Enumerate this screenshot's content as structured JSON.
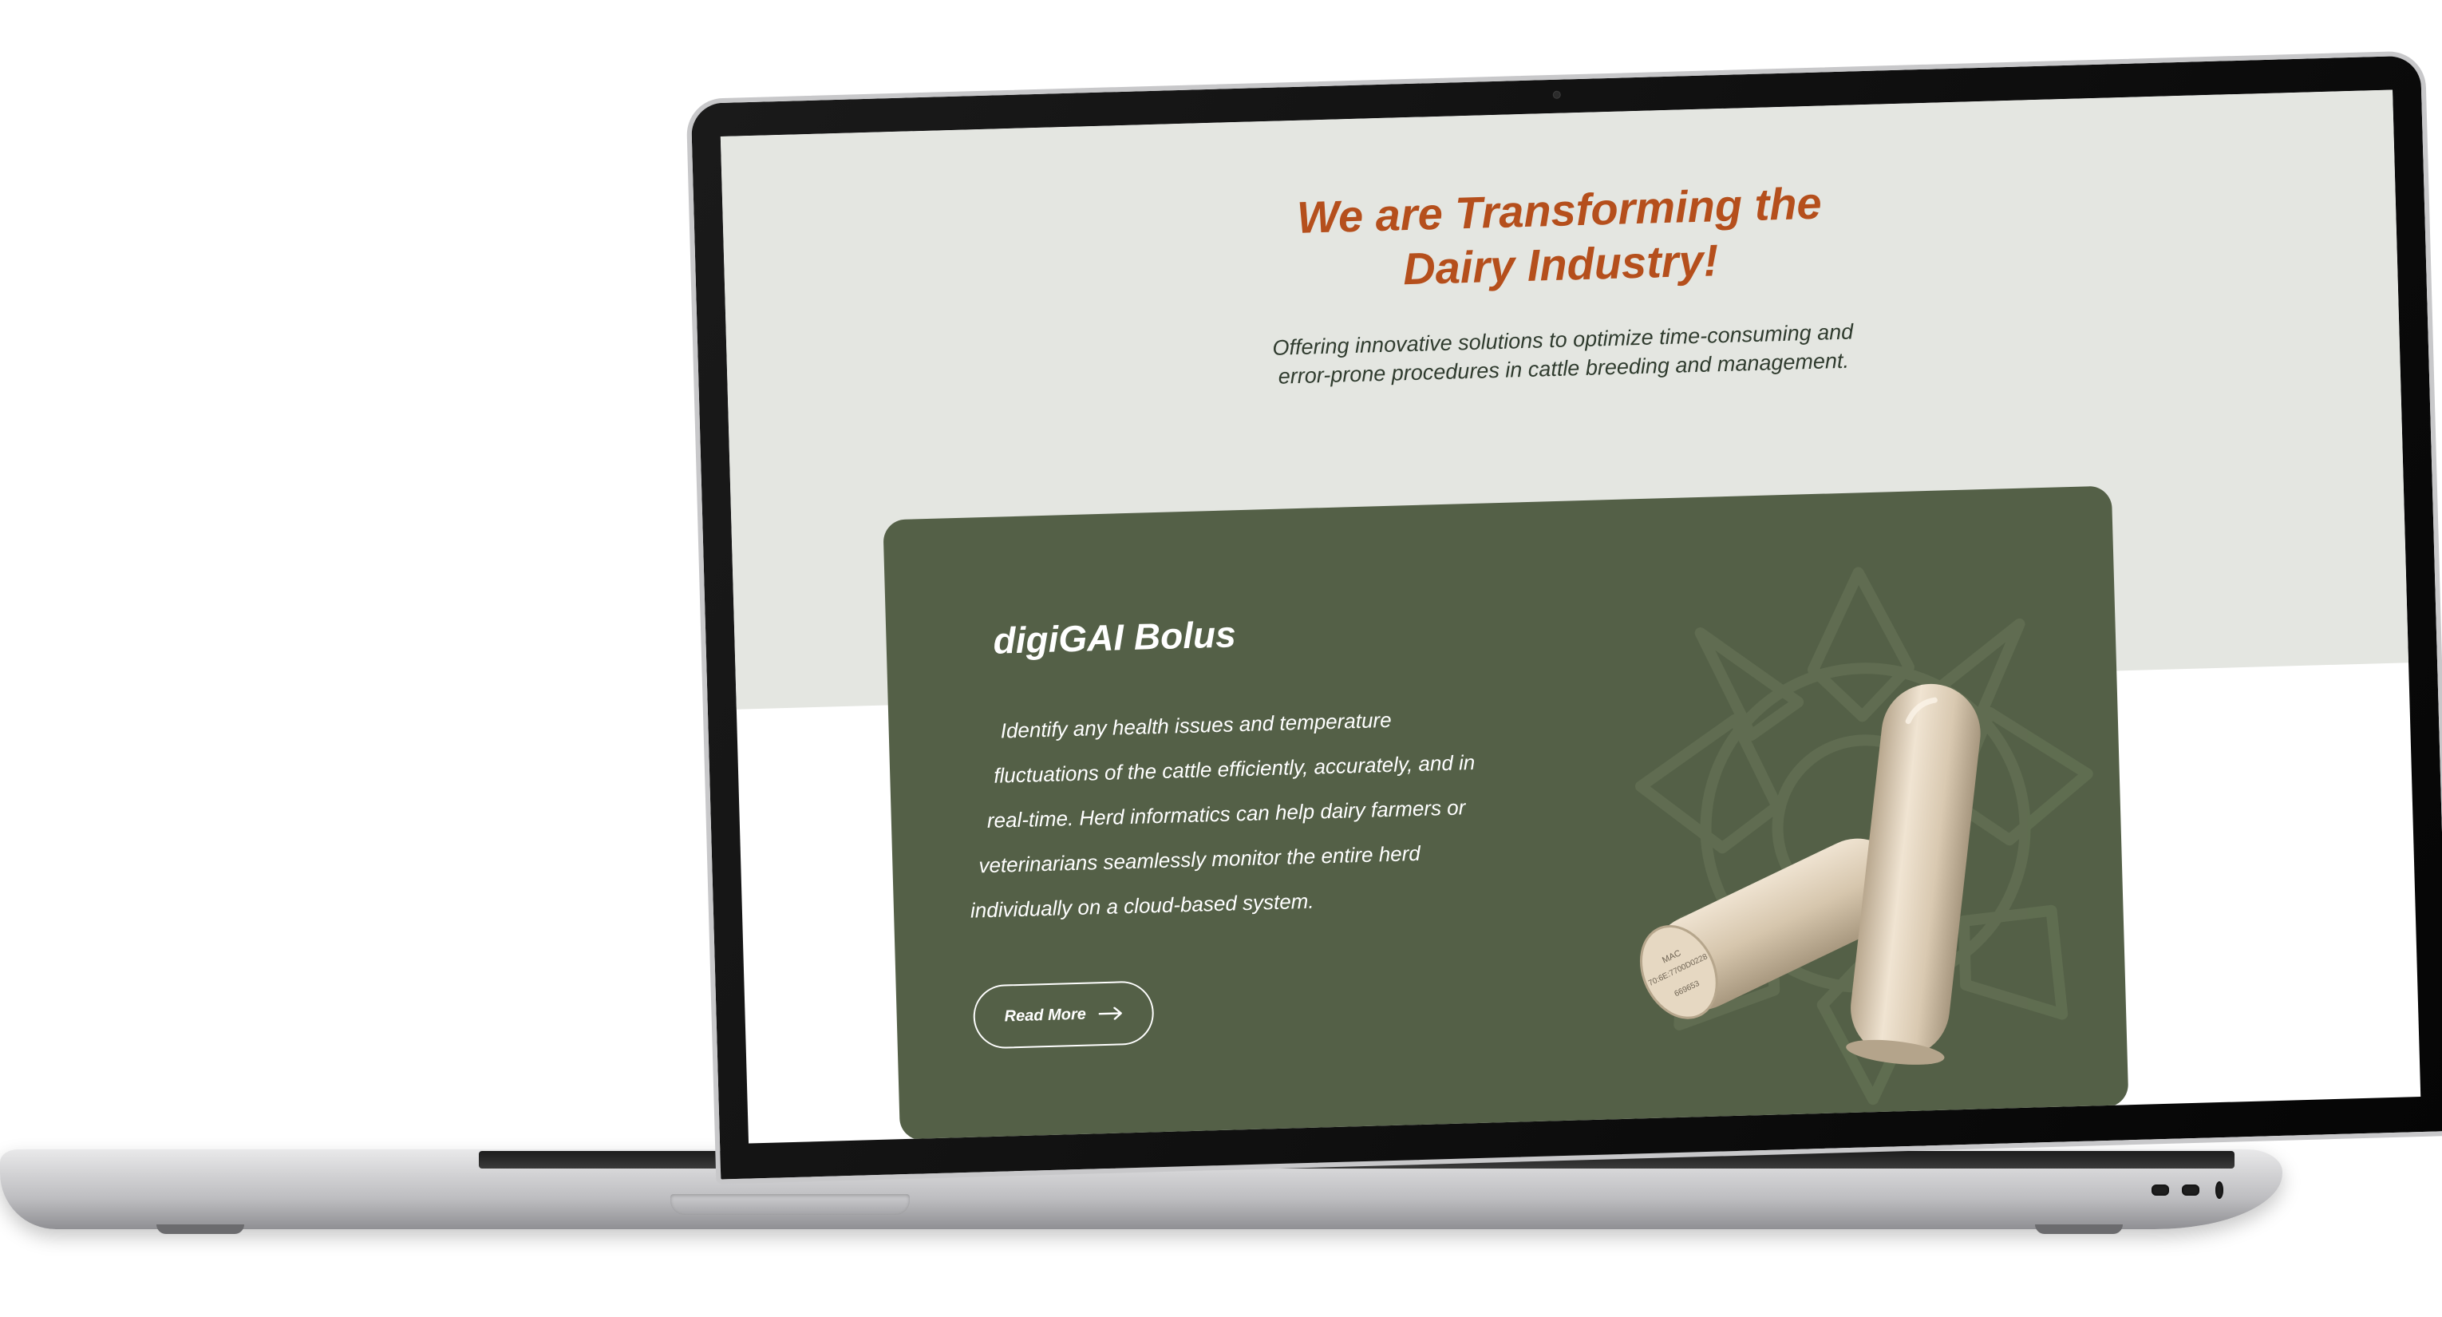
{
  "page": {
    "title_line1": "We are Transforming the",
    "title_line2": "Dairy Industry!",
    "subtitle_line1": "Offering innovative solutions to optimize time-consuming and",
    "subtitle_line2": "error-prone procedures in cattle breeding and management."
  },
  "product_card": {
    "title": "digiGAI Bolus",
    "description_lines": [
      "Identify any health issues and temperature",
      "fluctuations of the cattle efficiently, accurately, and in",
      "real-time. Herd informatics can help dairy farmers or",
      "veterinarians seamlessly monitor the entire herd",
      "individually on a cloud-based system."
    ],
    "button_label": "Read More",
    "button_icon": "arrow-right-icon",
    "image_icon": "bolus-capsules-image",
    "bolus_print": {
      "line1": "MAC",
      "line2": "70:6E:7700D0228",
      "line3": "669653"
    }
  },
  "colors": {
    "accent_title": "#b54f1c",
    "hero_background": "#e4e6e1",
    "card_background": "#546047",
    "capsule": "#d9c9b1"
  }
}
